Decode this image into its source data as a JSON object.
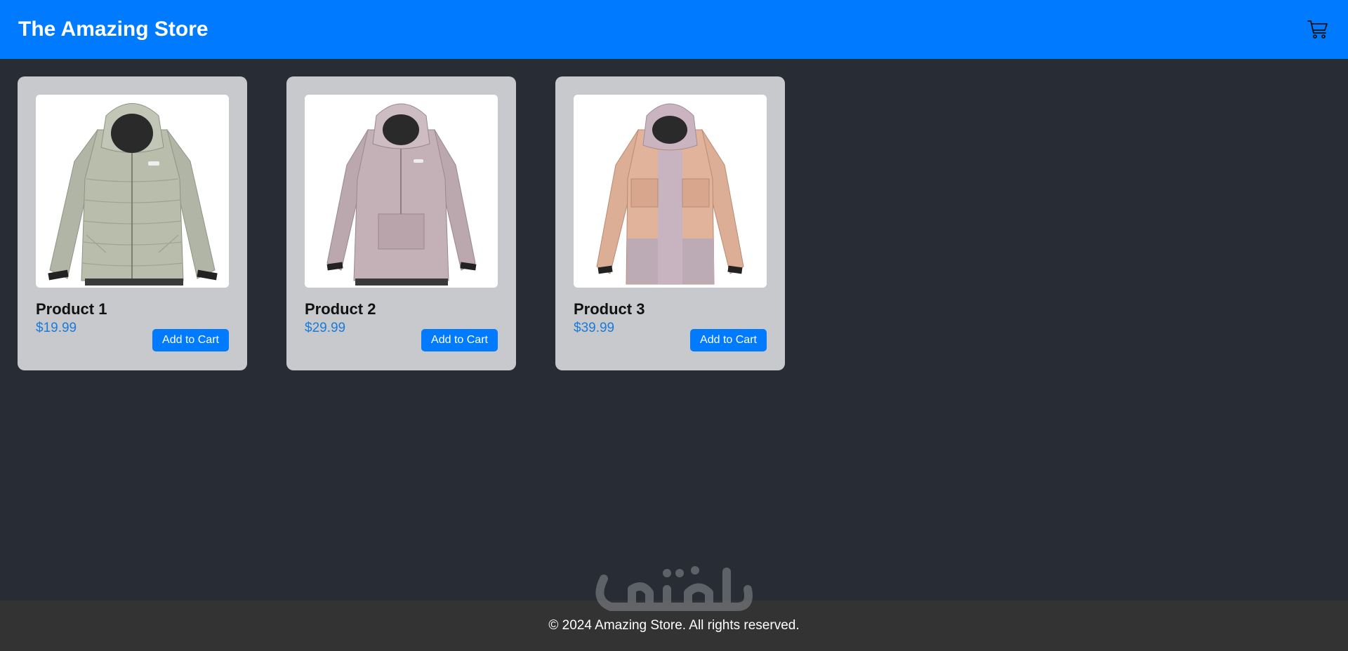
{
  "header": {
    "title": "The Amazing Store",
    "cart_icon": "cart-icon"
  },
  "products": [
    {
      "name": "Product 1",
      "price": "$19.99",
      "button_label": "Add to Cart",
      "image": "sage-green-puffer-jacket"
    },
    {
      "name": "Product 2",
      "price": "$29.99",
      "button_label": "Add to Cart",
      "image": "mauve-anorak-jacket"
    },
    {
      "name": "Product 3",
      "price": "$39.99",
      "button_label": "Add to Cart",
      "image": "peach-lilac-colorblock-jacket"
    }
  ],
  "footer": {
    "copyright": "© 2024 Amazing Store. All rights reserved."
  },
  "watermark": {
    "text": "مستقل mostaql.com"
  },
  "colors": {
    "header_bg": "#007bff",
    "page_bg": "#282c35",
    "card_bg": "#c8c9cc",
    "price": "#1a7bd9",
    "button_bg": "#007bff",
    "footer_bg": "#333333"
  }
}
